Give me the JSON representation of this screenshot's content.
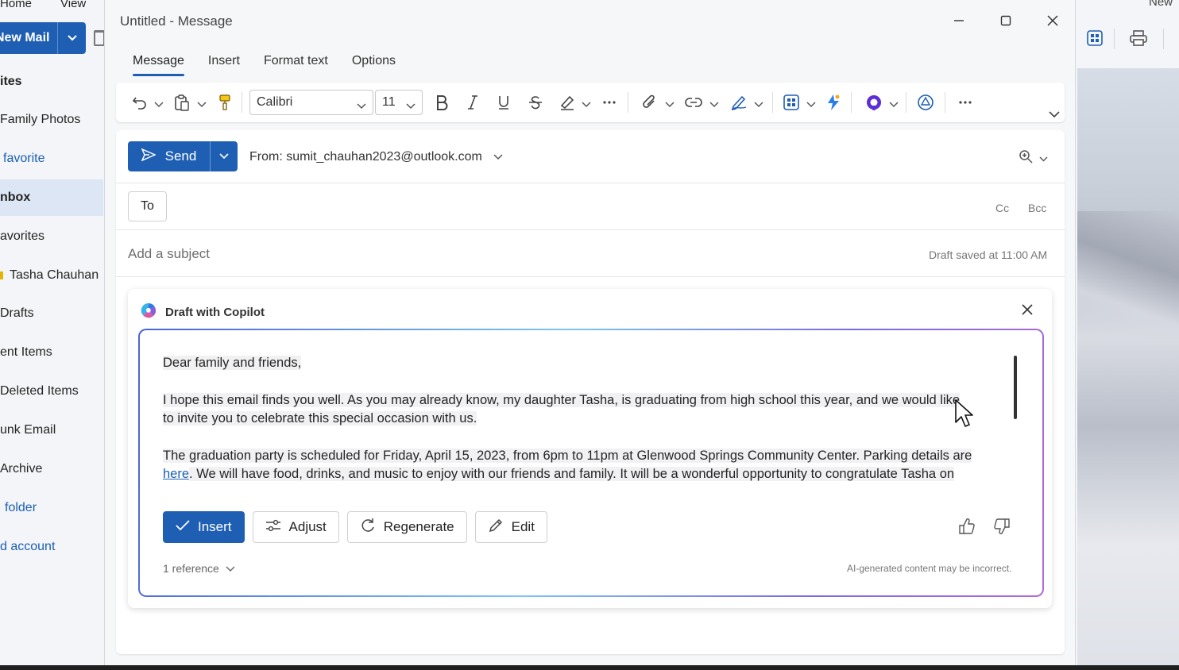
{
  "background_app": {
    "menu": [
      "Home",
      "View"
    ],
    "new_mail_label": "New Mail",
    "nav_items": [
      {
        "label": "ites",
        "style": "normal"
      },
      {
        "label": "Family Photos",
        "style": "normal"
      },
      {
        "label": "favorite",
        "style": "link"
      },
      {
        "label": "nbox",
        "style": "selected"
      },
      {
        "label": "avorites",
        "style": "normal"
      },
      {
        "label": "Tasha Chauhan",
        "style": "normal"
      },
      {
        "label": "Drafts",
        "style": "normal"
      },
      {
        "label": "ent Items",
        "style": "normal"
      },
      {
        "label": "Deleted Items",
        "style": "normal"
      },
      {
        "label": "unk Email",
        "style": "normal"
      },
      {
        "label": "Archive",
        "style": "normal"
      },
      {
        "label": "folder",
        "style": "link"
      },
      {
        "label": "d account",
        "style": "link"
      }
    ],
    "right_label": "New"
  },
  "window": {
    "title": "Untitled - Message"
  },
  "ribbon": {
    "tabs": [
      {
        "label": "Message",
        "active": true
      },
      {
        "label": "Insert",
        "active": false
      },
      {
        "label": "Format text",
        "active": false
      },
      {
        "label": "Options",
        "active": false
      }
    ],
    "font_name": "Calibri",
    "font_size": "11"
  },
  "compose": {
    "send_label": "Send",
    "from_text": "From: sumit_chauhan2023@outlook.com",
    "to_label": "To",
    "cc_label": "Cc",
    "bcc_label": "Bcc",
    "subject_placeholder": "Add a subject",
    "draft_status": "Draft saved at 11:00 AM"
  },
  "copilot": {
    "header": "Draft with Copilot",
    "greeting": "Dear family and friends,",
    "paragraph1_line1": "I hope this email finds you well. As you may already know, my daughter Tasha, is graduating from high school this year, and we would like",
    "paragraph1_line2": "to invite you to celebrate this special occasion with us.",
    "paragraph2_line1": "The graduation party is scheduled for Friday, April 15, 2023, from 6pm to 11pm at Glenwood Springs Community Center. Parking details are",
    "paragraph2_link": "here",
    "paragraph2_line2": ". We will have food, drinks, and music to enjoy with our friends and family. It will be a wonderful opportunity to congratulate Tasha on",
    "actions": {
      "insert": "Insert",
      "adjust": "Adjust",
      "regenerate": "Regenerate",
      "edit": "Edit"
    },
    "reference": "1 reference",
    "disclaimer": "AI-generated content may be incorrect."
  },
  "colors": {
    "accent": "#1f5fb3",
    "link": "#1a5fb4"
  }
}
